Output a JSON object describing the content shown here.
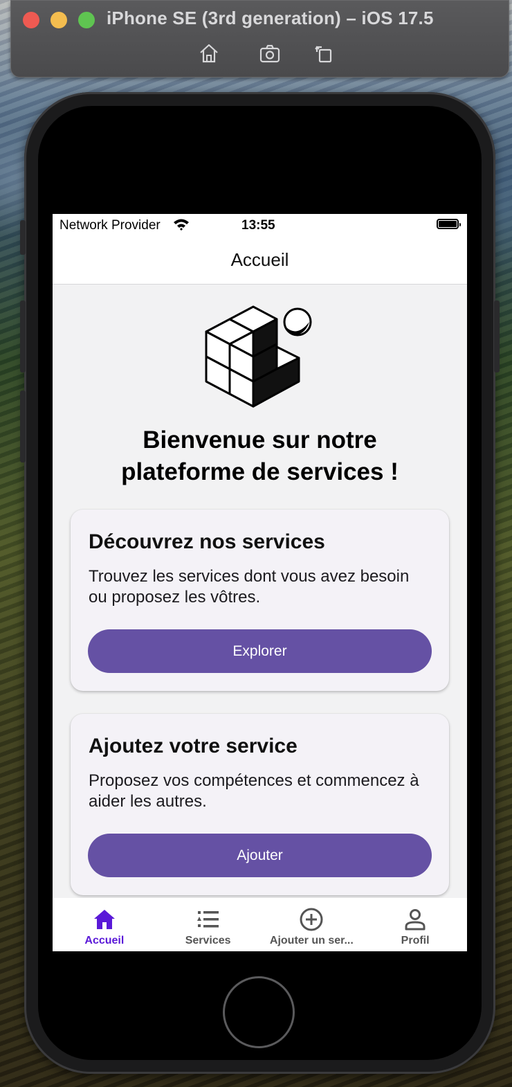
{
  "simulator": {
    "title": "iPhone SE (3rd generation) – iOS 17.5",
    "tools": [
      "home-icon",
      "screenshot-icon",
      "rotate-icon"
    ]
  },
  "status_bar": {
    "carrier": "Network Provider",
    "time": "13:55",
    "battery_level": 1.0
  },
  "nav": {
    "title": "Accueil"
  },
  "welcome": {
    "line1": "Bienvenue sur notre",
    "line2": "plateforme de services !"
  },
  "cards": [
    {
      "title": "Découvrez nos services",
      "text": "Trouvez les services dont vous avez besoin ou proposez les vôtres.",
      "button": "Explorer"
    },
    {
      "title": "Ajoutez votre service",
      "text": "Proposez vos compétences et commencez à aider les autres.",
      "button": "Ajouter"
    }
  ],
  "tabs": [
    {
      "label": "Accueil",
      "icon": "home-icon",
      "active": true
    },
    {
      "label": "Services",
      "icon": "list-icon",
      "active": false
    },
    {
      "label": "Ajouter un ser...",
      "icon": "plus-circle-icon",
      "active": false
    },
    {
      "label": "Profil",
      "icon": "person-icon",
      "active": false
    }
  ],
  "colors": {
    "primary_button": "#6551a4",
    "active_tab": "#5a19d8",
    "card_bg": "#f4f2f7",
    "screen_bg": "#f2f2f3"
  }
}
